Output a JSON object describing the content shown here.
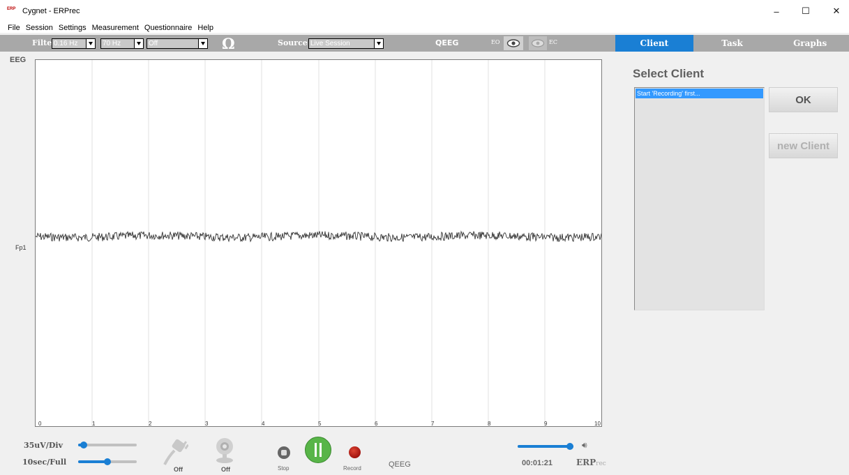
{
  "window": {
    "title": "Cygnet - ERPrec",
    "app_icon_text": "ERP",
    "minimize": "–",
    "maximize": "☐",
    "close": "✕"
  },
  "menu": [
    "File",
    "Session",
    "Settings",
    "Measurement",
    "Questionnaire",
    "Help"
  ],
  "toolbar": {
    "filter_label": "Filter",
    "filter_low": "0.16 Hz",
    "filter_high": "70 Hz",
    "filter_notch": "Off",
    "impedance_icon": "omega-icon",
    "source_label": "Source",
    "source_value": "Live Session",
    "qeeg_label": "QEEG",
    "eo_label": "EO",
    "ec_label": "EC"
  },
  "tabs": [
    {
      "label": "Client",
      "active": true
    },
    {
      "label": "Task",
      "active": false
    },
    {
      "label": "Graphs",
      "active": false
    }
  ],
  "eeg": {
    "title": "EEG",
    "channel": "Fp1",
    "ticks": [
      "0",
      "1",
      "2",
      "3",
      "4",
      "5",
      "6",
      "7",
      "8",
      "9",
      "10"
    ]
  },
  "client_panel": {
    "title": "Select Client",
    "list_items": [
      "Start 'Recording' first..."
    ],
    "ok_label": "OK",
    "new_client_label": "new Client"
  },
  "bottom": {
    "scale_label": "35uV/Div",
    "scale_level": 0.1,
    "time_label": "10sec/Full",
    "time_level": 0.5,
    "amplifier_status": "Off",
    "camera_status": "Off",
    "stop_label": "Stop",
    "record_label": "Record",
    "mode_label": "QEEG",
    "volume_level": 1.0,
    "timer": "00:01:21",
    "brand_main": "ERP",
    "brand_sub": "rec"
  },
  "colors": {
    "accent": "#1a7fd4",
    "toolbar_bg": "#a8a8a8",
    "play_green": "#58b548",
    "record_red": "#b22222"
  }
}
